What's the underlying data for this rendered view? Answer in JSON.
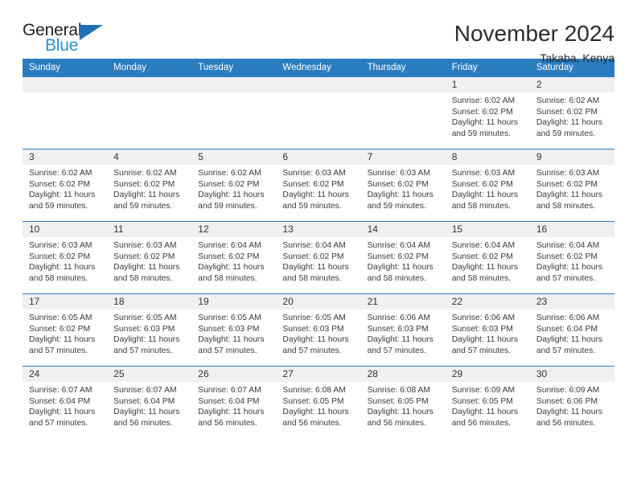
{
  "logo": {
    "word_top": "General",
    "word_bottom": "Blue",
    "triangle_color": "#1f6fb4",
    "blue_text_color": "#2b8fd4"
  },
  "header": {
    "title": "November 2024",
    "subtitle": "Takaba, Kenya"
  },
  "theme": {
    "header_blue": "#2b7cbf",
    "daynum_gray": "#f0f0f0"
  },
  "labels": {
    "sunrise_prefix": "Sunrise:",
    "sunset_prefix": "Sunset:",
    "daylight_prefix": "Daylight:"
  },
  "weekdays": [
    "Sunday",
    "Monday",
    "Tuesday",
    "Wednesday",
    "Thursday",
    "Friday",
    "Saturday"
  ],
  "weeks": [
    [
      {
        "day": "",
        "empty": true
      },
      {
        "day": "",
        "empty": true
      },
      {
        "day": "",
        "empty": true
      },
      {
        "day": "",
        "empty": true
      },
      {
        "day": "",
        "empty": true
      },
      {
        "day": "1",
        "sunrise": "Sunrise: 6:02 AM",
        "sunset": "Sunset: 6:02 PM",
        "daylight1": "Daylight: 11 hours",
        "daylight2": "and 59 minutes."
      },
      {
        "day": "2",
        "sunrise": "Sunrise: 6:02 AM",
        "sunset": "Sunset: 6:02 PM",
        "daylight1": "Daylight: 11 hours",
        "daylight2": "and 59 minutes."
      }
    ],
    [
      {
        "day": "3",
        "sunrise": "Sunrise: 6:02 AM",
        "sunset": "Sunset: 6:02 PM",
        "daylight1": "Daylight: 11 hours",
        "daylight2": "and 59 minutes."
      },
      {
        "day": "4",
        "sunrise": "Sunrise: 6:02 AM",
        "sunset": "Sunset: 6:02 PM",
        "daylight1": "Daylight: 11 hours",
        "daylight2": "and 59 minutes."
      },
      {
        "day": "5",
        "sunrise": "Sunrise: 6:02 AM",
        "sunset": "Sunset: 6:02 PM",
        "daylight1": "Daylight: 11 hours",
        "daylight2": "and 59 minutes."
      },
      {
        "day": "6",
        "sunrise": "Sunrise: 6:03 AM",
        "sunset": "Sunset: 6:02 PM",
        "daylight1": "Daylight: 11 hours",
        "daylight2": "and 59 minutes."
      },
      {
        "day": "7",
        "sunrise": "Sunrise: 6:03 AM",
        "sunset": "Sunset: 6:02 PM",
        "daylight1": "Daylight: 11 hours",
        "daylight2": "and 59 minutes."
      },
      {
        "day": "8",
        "sunrise": "Sunrise: 6:03 AM",
        "sunset": "Sunset: 6:02 PM",
        "daylight1": "Daylight: 11 hours",
        "daylight2": "and 58 minutes."
      },
      {
        "day": "9",
        "sunrise": "Sunrise: 6:03 AM",
        "sunset": "Sunset: 6:02 PM",
        "daylight1": "Daylight: 11 hours",
        "daylight2": "and 58 minutes."
      }
    ],
    [
      {
        "day": "10",
        "sunrise": "Sunrise: 6:03 AM",
        "sunset": "Sunset: 6:02 PM",
        "daylight1": "Daylight: 11 hours",
        "daylight2": "and 58 minutes."
      },
      {
        "day": "11",
        "sunrise": "Sunrise: 6:03 AM",
        "sunset": "Sunset: 6:02 PM",
        "daylight1": "Daylight: 11 hours",
        "daylight2": "and 58 minutes."
      },
      {
        "day": "12",
        "sunrise": "Sunrise: 6:04 AM",
        "sunset": "Sunset: 6:02 PM",
        "daylight1": "Daylight: 11 hours",
        "daylight2": "and 58 minutes."
      },
      {
        "day": "13",
        "sunrise": "Sunrise: 6:04 AM",
        "sunset": "Sunset: 6:02 PM",
        "daylight1": "Daylight: 11 hours",
        "daylight2": "and 58 minutes."
      },
      {
        "day": "14",
        "sunrise": "Sunrise: 6:04 AM",
        "sunset": "Sunset: 6:02 PM",
        "daylight1": "Daylight: 11 hours",
        "daylight2": "and 58 minutes."
      },
      {
        "day": "15",
        "sunrise": "Sunrise: 6:04 AM",
        "sunset": "Sunset: 6:02 PM",
        "daylight1": "Daylight: 11 hours",
        "daylight2": "and 58 minutes."
      },
      {
        "day": "16",
        "sunrise": "Sunrise: 6:04 AM",
        "sunset": "Sunset: 6:02 PM",
        "daylight1": "Daylight: 11 hours",
        "daylight2": "and 57 minutes."
      }
    ],
    [
      {
        "day": "17",
        "sunrise": "Sunrise: 6:05 AM",
        "sunset": "Sunset: 6:02 PM",
        "daylight1": "Daylight: 11 hours",
        "daylight2": "and 57 minutes."
      },
      {
        "day": "18",
        "sunrise": "Sunrise: 6:05 AM",
        "sunset": "Sunset: 6:03 PM",
        "daylight1": "Daylight: 11 hours",
        "daylight2": "and 57 minutes."
      },
      {
        "day": "19",
        "sunrise": "Sunrise: 6:05 AM",
        "sunset": "Sunset: 6:03 PM",
        "daylight1": "Daylight: 11 hours",
        "daylight2": "and 57 minutes."
      },
      {
        "day": "20",
        "sunrise": "Sunrise: 6:05 AM",
        "sunset": "Sunset: 6:03 PM",
        "daylight1": "Daylight: 11 hours",
        "daylight2": "and 57 minutes."
      },
      {
        "day": "21",
        "sunrise": "Sunrise: 6:06 AM",
        "sunset": "Sunset: 6:03 PM",
        "daylight1": "Daylight: 11 hours",
        "daylight2": "and 57 minutes."
      },
      {
        "day": "22",
        "sunrise": "Sunrise: 6:06 AM",
        "sunset": "Sunset: 6:03 PM",
        "daylight1": "Daylight: 11 hours",
        "daylight2": "and 57 minutes."
      },
      {
        "day": "23",
        "sunrise": "Sunrise: 6:06 AM",
        "sunset": "Sunset: 6:04 PM",
        "daylight1": "Daylight: 11 hours",
        "daylight2": "and 57 minutes."
      }
    ],
    [
      {
        "day": "24",
        "sunrise": "Sunrise: 6:07 AM",
        "sunset": "Sunset: 6:04 PM",
        "daylight1": "Daylight: 11 hours",
        "daylight2": "and 57 minutes."
      },
      {
        "day": "25",
        "sunrise": "Sunrise: 6:07 AM",
        "sunset": "Sunset: 6:04 PM",
        "daylight1": "Daylight: 11 hours",
        "daylight2": "and 56 minutes."
      },
      {
        "day": "26",
        "sunrise": "Sunrise: 6:07 AM",
        "sunset": "Sunset: 6:04 PM",
        "daylight1": "Daylight: 11 hours",
        "daylight2": "and 56 minutes."
      },
      {
        "day": "27",
        "sunrise": "Sunrise: 6:08 AM",
        "sunset": "Sunset: 6:05 PM",
        "daylight1": "Daylight: 11 hours",
        "daylight2": "and 56 minutes."
      },
      {
        "day": "28",
        "sunrise": "Sunrise: 6:08 AM",
        "sunset": "Sunset: 6:05 PM",
        "daylight1": "Daylight: 11 hours",
        "daylight2": "and 56 minutes."
      },
      {
        "day": "29",
        "sunrise": "Sunrise: 6:09 AM",
        "sunset": "Sunset: 6:05 PM",
        "daylight1": "Daylight: 11 hours",
        "daylight2": "and 56 minutes."
      },
      {
        "day": "30",
        "sunrise": "Sunrise: 6:09 AM",
        "sunset": "Sunset: 6:06 PM",
        "daylight1": "Daylight: 11 hours",
        "daylight2": "and 56 minutes."
      }
    ]
  ]
}
